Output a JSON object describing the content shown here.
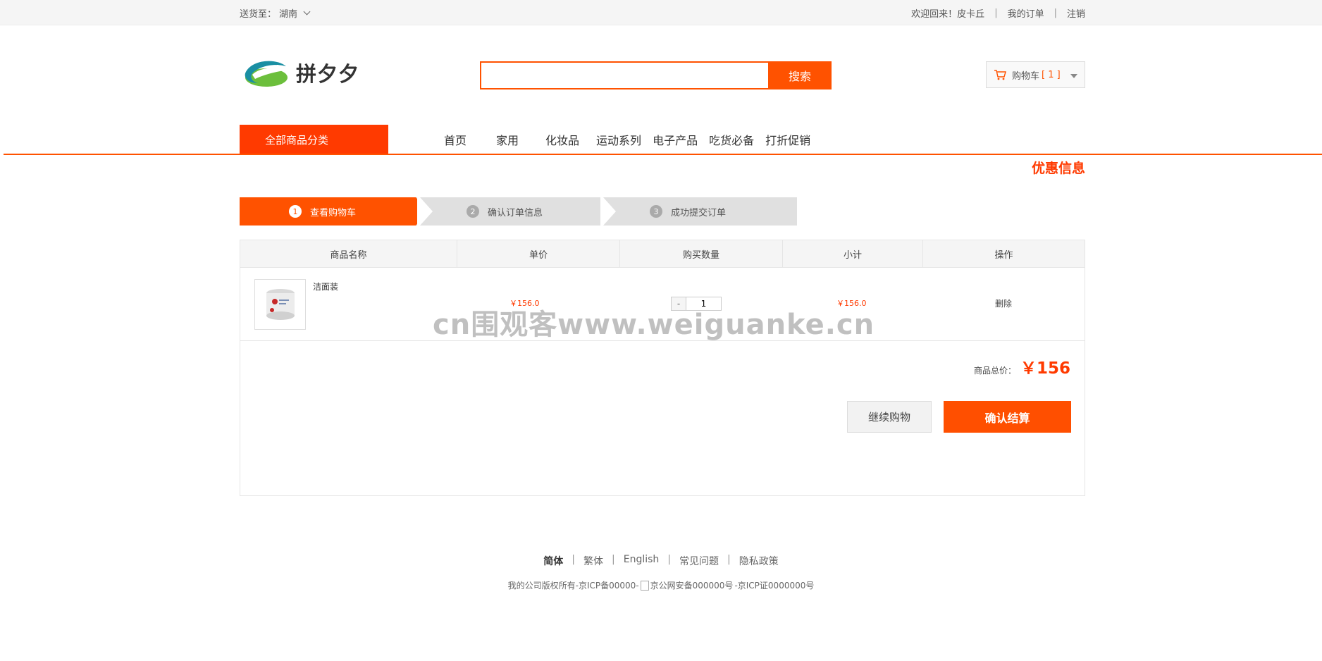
{
  "topbar": {
    "ship_label": "送货至：",
    "ship_region": "湖南",
    "welcome": "欢迎回来！",
    "username": "皮卡丘",
    "sep": "|",
    "my_orders": "我的订单",
    "logout": "注销"
  },
  "header": {
    "logo_text": "拼夕夕",
    "search_placeholder": "",
    "search_button": "搜索",
    "cart_label": "购物车",
    "cart_count": "[ 1 ]"
  },
  "nav": {
    "all_categories": "全部商品分类",
    "items": [
      "首页",
      "家用",
      "化妆品",
      "运动系列",
      "电子产品",
      "吃货必备",
      "打折促销"
    ],
    "promo": "优惠信息"
  },
  "steps": [
    {
      "num": "1",
      "label": "查看购物车"
    },
    {
      "num": "2",
      "label": "确认订单信息"
    },
    {
      "num": "3",
      "label": "成功提交订单"
    }
  ],
  "table": {
    "headers": [
      "商品名称",
      "单价",
      "购买数量",
      "小计",
      "操作"
    ],
    "rows": [
      {
        "name": "洁面装",
        "price": "￥156.0",
        "qty": "1",
        "subtotal": "￥156.0",
        "action": "删除"
      }
    ],
    "qty_minus": "-",
    "total_label": "商品总价：",
    "total_value": "￥156",
    "continue_button": "继续购物",
    "checkout_button": "确认结算"
  },
  "watermark": "cn围观客www.weiguanke.cn",
  "footer": {
    "links": [
      "简体",
      "繁体",
      "English",
      "常见问题",
      "隐私政策"
    ],
    "sep": "|",
    "copyright": "我的公司版权所有-京ICP备00000-",
    "img_alt": "京公网安备000000号",
    "icp": "-京ICP证0000000号"
  },
  "colors": {
    "accent": "#ff5200",
    "accent_dark": "#ff3a00"
  }
}
